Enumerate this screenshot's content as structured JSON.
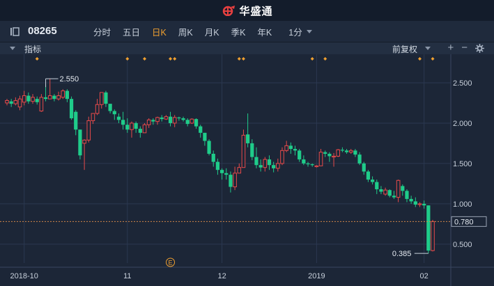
{
  "app": {
    "brand": "华盛通"
  },
  "stock": {
    "code": "08265"
  },
  "periods": [
    {
      "label": "分时",
      "active": false
    },
    {
      "label": "五日",
      "active": false
    },
    {
      "label": "日K",
      "active": true
    },
    {
      "label": "周K",
      "active": false
    },
    {
      "label": "月K",
      "active": false
    },
    {
      "label": "季K",
      "active": false
    },
    {
      "label": "年K",
      "active": false
    }
  ],
  "minute_dropdown": {
    "label": "1分"
  },
  "indicator_bar": {
    "label": "指标",
    "adjust_label": "前复权",
    "add": "+",
    "remove": "−"
  },
  "colors": {
    "up": "#e84a4a",
    "down": "#1fcc8a",
    "accent": "#f0a030",
    "price_line": "#d4894a",
    "marker": "#f0a030"
  },
  "icons": [
    "pencil-icon",
    "expand-icon",
    "exit-icon",
    "gear-icon"
  ],
  "chart_data": {
    "type": "candlestick",
    "y_ticks": [
      "2.500",
      "2.000",
      "1.500",
      "1.000",
      "0.500"
    ],
    "ylim": [
      0.3,
      2.75
    ],
    "x_ticks": [
      {
        "label": "2018-10",
        "index": 4
      },
      {
        "label": "11",
        "index": 28
      },
      {
        "label": "12",
        "index": 50
      },
      {
        "label": "2019",
        "index": 72
      },
      {
        "label": "02",
        "index": 97
      }
    ],
    "current_price": "0.780",
    "max_label": {
      "text": "2.550",
      "index": 9,
      "value": 2.55
    },
    "min_label": {
      "text": "0.385",
      "index": 98,
      "value": 0.385
    },
    "event_marker": {
      "text": "E",
      "index": 38
    },
    "top_markers": [
      7,
      28,
      32,
      38,
      39,
      54,
      55,
      71,
      74,
      96,
      99
    ],
    "candles": [
      [
        2.25,
        2.28,
        2.3,
        2.22
      ],
      [
        2.27,
        2.24,
        2.3,
        2.2
      ],
      [
        2.24,
        2.28,
        2.32,
        2.22
      ],
      [
        2.2,
        2.3,
        2.34,
        2.16
      ],
      [
        2.26,
        2.34,
        2.4,
        2.22
      ],
      [
        2.34,
        2.27,
        2.38,
        2.24
      ],
      [
        2.27,
        2.32,
        2.36,
        2.24
      ],
      [
        2.3,
        2.26,
        2.33,
        2.23
      ],
      [
        2.15,
        2.32,
        2.36,
        2.14
      ],
      [
        2.32,
        2.3,
        2.48,
        2.27
      ],
      [
        2.3,
        2.34,
        2.55,
        2.3
      ],
      [
        2.34,
        2.3,
        2.36,
        2.27
      ],
      [
        2.3,
        2.34,
        2.39,
        2.28
      ],
      [
        2.32,
        2.4,
        2.42,
        2.3
      ],
      [
        2.4,
        2.3,
        2.42,
        2.26
      ],
      [
        2.3,
        2.06,
        2.33,
        2.04
      ],
      [
        2.14,
        1.92,
        2.16,
        1.85
      ],
      [
        1.92,
        1.6,
        1.92,
        1.55
      ],
      [
        1.75,
        1.79,
        1.8,
        1.42
      ],
      [
        1.79,
        2.03,
        2.08,
        1.76
      ],
      [
        2.03,
        2.12,
        2.12,
        1.99
      ],
      [
        2.12,
        2.23,
        2.3,
        2.1
      ],
      [
        2.23,
        2.38,
        2.38,
        2.18
      ],
      [
        2.38,
        2.24,
        2.4,
        2.2
      ],
      [
        2.24,
        2.15,
        2.22,
        2.12
      ],
      [
        2.15,
        2.11,
        2.17,
        2.04
      ],
      [
        2.08,
        2.04,
        2.12,
        2.0
      ],
      [
        2.04,
        1.98,
        2.14,
        1.92
      ],
      [
        1.98,
        1.92,
        2.06,
        1.88
      ],
      [
        1.92,
        2.0,
        2.02,
        1.82
      ],
      [
        2.0,
        1.93,
        2.02,
        1.88
      ],
      [
        1.93,
        1.88,
        1.96,
        1.82
      ],
      [
        1.88,
        1.98,
        2.0,
        1.88
      ],
      [
        1.98,
        2.04,
        2.06,
        1.94
      ],
      [
        2.04,
        2.02,
        2.06,
        1.98
      ],
      [
        2.02,
        2.07,
        2.08,
        1.98
      ],
      [
        2.07,
        2.05,
        2.1,
        2.02
      ],
      [
        2.05,
        2.08,
        2.1,
        2.04
      ],
      [
        2.08,
        2.0,
        2.14,
        1.96
      ],
      [
        2.0,
        2.07,
        2.1,
        1.95
      ],
      [
        2.07,
        2.06,
        2.08,
        2.03
      ],
      [
        2.06,
        2.04,
        2.08,
        2.02
      ],
      [
        2.04,
        1.99,
        2.06,
        1.96
      ],
      [
        2.0,
        2.05,
        2.06,
        1.99
      ],
      [
        2.05,
        1.96,
        2.06,
        1.93
      ],
      [
        1.96,
        1.88,
        1.98,
        1.82
      ],
      [
        1.88,
        1.78,
        1.88,
        1.72
      ],
      [
        1.78,
        1.62,
        1.8,
        1.6
      ],
      [
        1.62,
        1.52,
        1.66,
        1.46
      ],
      [
        1.52,
        1.42,
        1.56,
        1.36
      ],
      [
        1.42,
        1.38,
        1.44,
        1.3
      ],
      [
        1.38,
        1.36,
        1.44,
        1.3
      ],
      [
        1.36,
        1.21,
        1.4,
        1.14
      ],
      [
        1.21,
        1.38,
        1.46,
        1.17
      ],
      [
        1.38,
        1.45,
        1.5,
        1.38
      ],
      [
        1.45,
        1.85,
        1.92,
        1.45
      ],
      [
        1.86,
        1.75,
        2.12,
        1.7
      ],
      [
        1.75,
        1.58,
        1.8,
        1.54
      ],
      [
        1.58,
        1.48,
        1.7,
        1.44
      ],
      [
        1.48,
        1.45,
        1.55,
        1.4
      ],
      [
        1.45,
        1.55,
        1.58,
        1.4
      ],
      [
        1.55,
        1.48,
        1.6,
        1.42
      ],
      [
        1.48,
        1.44,
        1.52,
        1.39
      ],
      [
        1.44,
        1.5,
        1.56,
        1.4
      ],
      [
        1.5,
        1.66,
        1.7,
        1.48
      ],
      [
        1.66,
        1.72,
        1.78,
        1.64
      ],
      [
        1.72,
        1.68,
        1.76,
        1.62
      ],
      [
        1.68,
        1.66,
        1.72,
        1.6
      ],
      [
        1.66,
        1.55,
        1.68,
        1.52
      ],
      [
        1.55,
        1.5,
        1.6,
        1.48
      ],
      [
        1.5,
        1.49,
        1.52,
        1.46
      ],
      [
        1.49,
        1.48,
        1.5,
        1.46
      ],
      [
        1.47,
        1.47,
        1.48,
        1.45
      ],
      [
        1.47,
        1.64,
        1.68,
        1.6
      ],
      [
        1.64,
        1.62,
        1.66,
        1.58
      ],
      [
        1.62,
        1.59,
        1.64,
        1.52
      ],
      [
        1.59,
        1.59,
        1.63,
        1.46
      ],
      [
        1.59,
        1.67,
        1.68,
        1.58
      ],
      [
        1.67,
        1.66,
        1.7,
        1.64
      ],
      [
        1.66,
        1.64,
        1.68,
        1.62
      ],
      [
        1.64,
        1.66,
        1.68,
        1.62
      ],
      [
        1.66,
        1.61,
        1.68,
        1.58
      ],
      [
        1.61,
        1.5,
        1.64,
        1.48
      ],
      [
        1.5,
        1.4,
        1.52,
        1.36
      ],
      [
        1.4,
        1.3,
        1.42,
        1.27
      ],
      [
        1.3,
        1.27,
        1.34,
        1.24
      ],
      [
        1.27,
        1.18,
        1.3,
        1.12
      ],
      [
        1.18,
        1.15,
        1.22,
        1.12
      ],
      [
        1.12,
        1.17,
        1.2,
        1.1
      ],
      [
        1.17,
        1.1,
        1.18,
        1.08
      ],
      [
        1.1,
        1.08,
        1.16,
        1.06
      ],
      [
        1.08,
        1.29,
        1.3,
        1.02
      ],
      [
        1.22,
        1.16,
        1.24,
        1.1
      ],
      [
        1.16,
        1.06,
        1.18,
        1.02
      ],
      [
        1.06,
        1.03,
        1.1,
        1.0
      ],
      [
        1.03,
        0.99,
        1.08,
        0.96
      ],
      [
        0.99,
        1.0,
        1.02,
        0.96
      ],
      [
        1.0,
        0.98,
        1.04,
        0.94
      ],
      [
        0.98,
        0.42,
        0.98,
        0.385
      ],
      [
        0.42,
        0.78,
        0.8,
        0.41
      ]
    ]
  }
}
